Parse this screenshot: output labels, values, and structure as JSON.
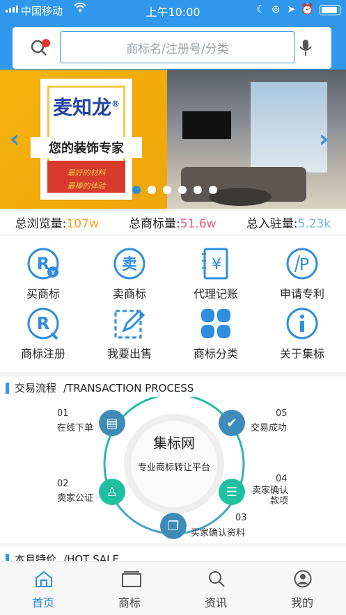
{
  "status_bar": {
    "carrier": "中国移动",
    "time": "上午10:00"
  },
  "search": {
    "placeholder": "商标名/注册号/分类"
  },
  "banner": {
    "brand": "麦知龙",
    "registered": "®",
    "slogan": "您的装饰专家",
    "sub1": "最好的材料",
    "sub2": "最棒的体验",
    "slide_count": 6,
    "active_slide": 1
  },
  "stats": {
    "views_label": "总浏览量:",
    "views_value": "107w",
    "marks_label": "总商标量:",
    "marks_value": "51.6w",
    "joined_label": "总入驻量:",
    "joined_value": "5.23k"
  },
  "grid": {
    "items": [
      {
        "label": "买商标",
        "icon": "buy-trademark-icon"
      },
      {
        "label": "卖商标",
        "icon": "sell-trademark-icon",
        "glyph": "卖"
      },
      {
        "label": "代理记账",
        "icon": "bookkeeping-icon",
        "glyph": "¥"
      },
      {
        "label": "申请专利",
        "icon": "patent-icon"
      },
      {
        "label": "商标注册",
        "icon": "register-icon"
      },
      {
        "label": "我要出售",
        "icon": "edit-sell-icon"
      },
      {
        "label": "商标分类",
        "icon": "category-icon"
      },
      {
        "label": "关于集标",
        "icon": "info-icon"
      }
    ]
  },
  "process": {
    "title": "交易流程",
    "subtitle": "/TRANSACTION PROCESS",
    "center_title": "集标网",
    "center_sub": "专业商标转让平台",
    "steps": [
      {
        "num": "01",
        "label": "在线下单"
      },
      {
        "num": "02",
        "label": "卖家公证"
      },
      {
        "num": "03",
        "label": "买家确认资料"
      },
      {
        "num": "04",
        "label": "卖家确认款项"
      },
      {
        "num": "05",
        "label": "交易成功"
      }
    ]
  },
  "hot_sale": {
    "title": "本月特价",
    "subtitle": "/HOT SALE"
  },
  "tabs": [
    {
      "label": "首页",
      "icon": "home-icon"
    },
    {
      "label": "商标",
      "icon": "trademark-icon"
    },
    {
      "label": "资讯",
      "icon": "news-search-icon"
    },
    {
      "label": "我的",
      "icon": "profile-icon"
    }
  ],
  "colors": {
    "accent": "#2f97ec",
    "teal": "#1fbfa2",
    "steel": "#3f8bb8"
  }
}
